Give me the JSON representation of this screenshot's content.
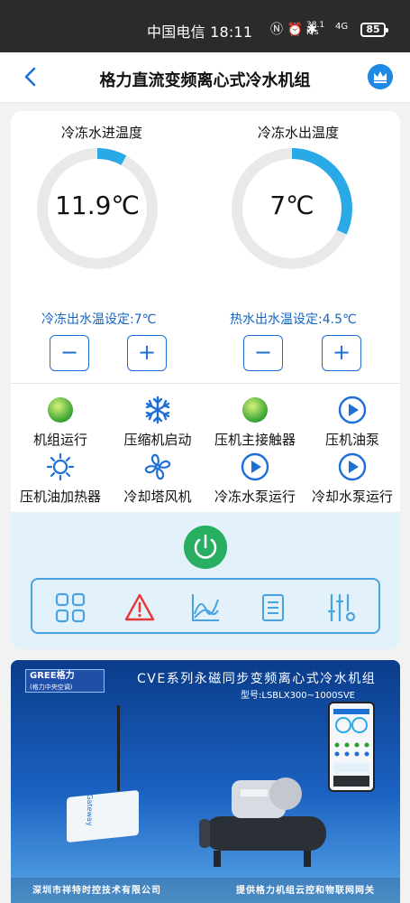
{
  "status_bar": {
    "carrier_time": "中国电信 18:11",
    "net_speed_value": "38.1",
    "net_speed_unit": "K/s",
    "network_type": "4G",
    "battery": "85"
  },
  "header": {
    "title": "格力直流变频离心式冷水机组",
    "back_icon": "chevron-left-icon",
    "crown_icon": "crown-icon"
  },
  "gauges": [
    {
      "label": "冷冻水进温度",
      "value": "11.9℃",
      "fill_fraction": 0.08,
      "color": "#29a9e6"
    },
    {
      "label": "冷冻水出温度",
      "value": "7℃",
      "fill_fraction": 0.32,
      "color": "#29a9e6"
    }
  ],
  "setpoints": [
    {
      "label": "冷冻出水温设定:7℃",
      "minus": "−",
      "plus": "+"
    },
    {
      "label": "热水出水温设定:4.5℃",
      "minus": "−",
      "plus": "+"
    }
  ],
  "status_items": [
    {
      "label": "机组运行",
      "icon": "green-indicator-icon"
    },
    {
      "label": "压缩机启动",
      "icon": "snowflake-icon"
    },
    {
      "label": "压机主接触器",
      "icon": "green-indicator-icon"
    },
    {
      "label": "压机油泵",
      "icon": "pump-icon"
    },
    {
      "label": "压机油加热器",
      "icon": "sun-icon"
    },
    {
      "label": "冷却塔风机",
      "icon": "fan-icon"
    },
    {
      "label": "冷冻水泵运行",
      "icon": "pump-icon"
    },
    {
      "label": "冷却水泵运行",
      "icon": "pump-icon"
    }
  ],
  "controls": {
    "power_icon": "power-icon",
    "tools": [
      "grid-icon",
      "alarm-icon",
      "chart-icon",
      "list-icon",
      "settings-sliders-icon"
    ]
  },
  "colors": {
    "accent": "#1e6fd6",
    "gauge": "#29a9e6",
    "power": "#27ae60",
    "alarm": "#e53935",
    "control_bg": "#e3f1fb"
  },
  "banner": {
    "logo_main": "GREE格力",
    "logo_sub": "(格力中央空调)",
    "series": "CVE系列永磁同步变频离心式冷水机组",
    "model": "型号:LSBLX300~1000SVE",
    "company": "深圳市祥特时控技术有限公司",
    "slogan": "提供格力机组云控和物联网网关",
    "device_brand": "Gateway"
  }
}
